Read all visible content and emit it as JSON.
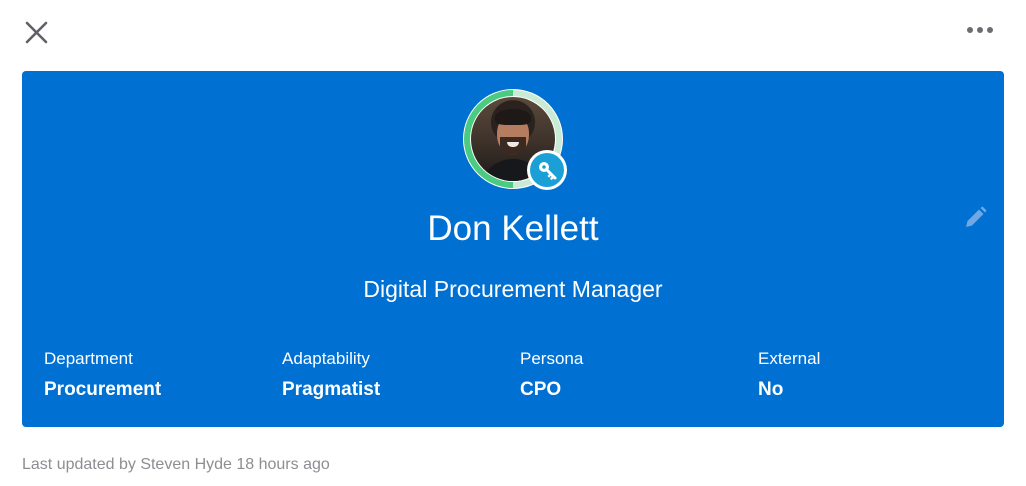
{
  "header": {
    "close_icon": "close-icon",
    "more_icon": "more-options-icon"
  },
  "profile": {
    "name": "Don Kellett",
    "title": "Digital Procurement Manager",
    "avatar_badge_icon": "key-icon",
    "edit_icon": "pencil-icon",
    "card_color": "#0070d2",
    "ring_color": "#4bca81",
    "badge_color": "#1b9fd7",
    "fields": [
      {
        "label": "Department",
        "value": "Procurement"
      },
      {
        "label": "Adaptability",
        "value": "Pragmatist"
      },
      {
        "label": "Persona",
        "value": "CPO"
      },
      {
        "label": "External",
        "value": "No"
      }
    ]
  },
  "footer": {
    "last_updated": "Last updated by Steven Hyde 18 hours ago"
  }
}
